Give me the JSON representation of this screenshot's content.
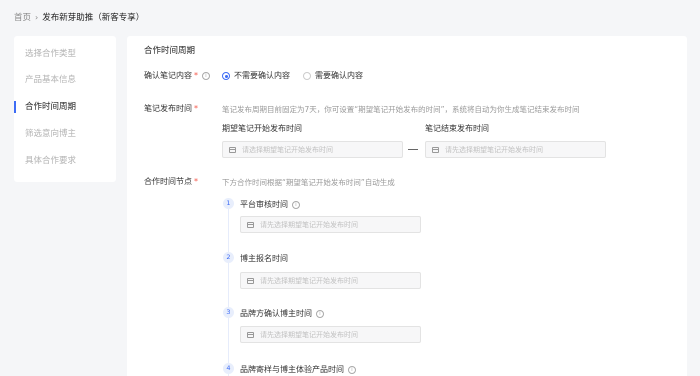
{
  "breadcrumb": {
    "home": "首页",
    "separator": "›",
    "current": "发布新芽助推（新客专享）"
  },
  "sidebar": {
    "items": [
      {
        "label": "选择合作类型"
      },
      {
        "label": "产品基本信息"
      },
      {
        "label": "合作时间周期"
      },
      {
        "label": "筛选意向博主"
      },
      {
        "label": "具体合作要求"
      }
    ]
  },
  "main": {
    "section_title": "合作时间周期",
    "confirm": {
      "label": "确认笔记内容",
      "required_mark": "*",
      "options": [
        {
          "label": "不需要确认内容",
          "selected": true
        },
        {
          "label": "需要确认内容",
          "selected": false
        }
      ]
    },
    "publish": {
      "label": "笔记发布时间",
      "required_mark": "*",
      "hint": "笔记发布周期目前固定为7天，你可设置“期望笔记开始发布的时间”，系统将自动为你生成笔记结束发布时间",
      "start_label": "期望笔记开始发布时间",
      "end_label": "笔记结束发布时间",
      "start_placeholder": "请选择期望笔记开始发布时间",
      "end_placeholder": "请先选择期望笔记开始发布时间"
    },
    "nodes": {
      "label": "合作时间节点",
      "required_mark": "*",
      "hint": "下方合作时间根据“期望笔记开始发布时间”自动生成",
      "steps": [
        {
          "num": "1",
          "label": "平台审核时间",
          "has_info": true,
          "placeholder": "请先选择期望笔记开始发布时间"
        },
        {
          "num": "2",
          "label": "博主报名时间",
          "has_info": false,
          "placeholder": "请先选择期望笔记开始发布时间"
        },
        {
          "num": "3",
          "label": "品牌方确认博主时间",
          "has_info": true,
          "placeholder": "请先选择期望笔记开始发布时间"
        },
        {
          "num": "4",
          "label": "品牌寄样与博主体验产品时间",
          "has_info": true
        }
      ]
    }
  },
  "colors": {
    "accent": "#3d6cf5",
    "required": "#f5584a",
    "page_bg": "#f5f6f8",
    "hint": "#999999"
  }
}
